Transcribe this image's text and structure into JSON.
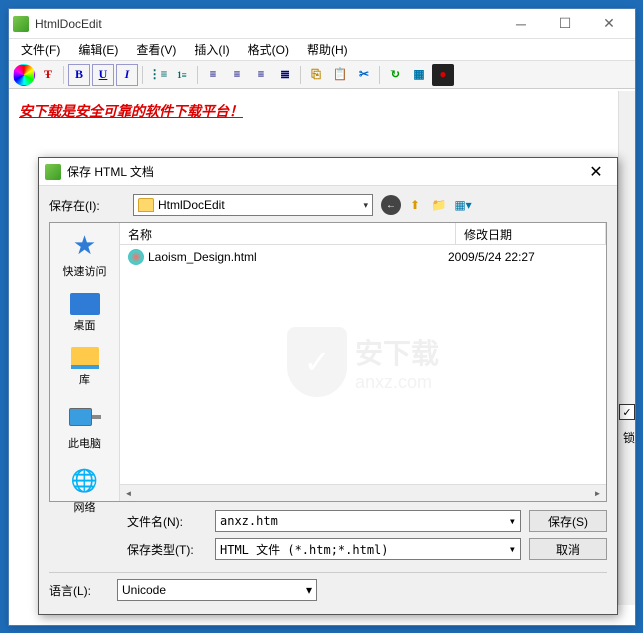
{
  "main": {
    "title": "HtmlDocEdit",
    "menus": [
      "文件(F)",
      "编辑(E)",
      "查看(V)",
      "插入(I)",
      "格式(O)",
      "帮助(H)"
    ],
    "editor_text": "安下载是安全可靠的软件下载平台！"
  },
  "dialog": {
    "title": "保存 HTML 文档",
    "save_in_label": "保存在(I):",
    "save_in_value": "HtmlDocEdit",
    "columns": {
      "name": "名称",
      "date": "修改日期"
    },
    "files": [
      {
        "name": "Laoism_Design.html",
        "date": "2009/5/24 22:27"
      }
    ],
    "sidebar": {
      "quick": "快速访问",
      "desktop": "桌面",
      "library": "库",
      "computer": "此电脑",
      "network": "网络"
    },
    "filename_label": "文件名(N):",
    "filename_value": "anxz.htm",
    "filetype_label": "保存类型(T):",
    "filetype_value": "HTML 文件 (*.htm;*.html)",
    "save_btn": "保存(S)",
    "cancel_btn": "取消",
    "lang_label": "语言(L):",
    "lang_value": "Unicode"
  },
  "watermark": {
    "cn": "安下载",
    "en": "anxz.com"
  },
  "right_label": "锁"
}
